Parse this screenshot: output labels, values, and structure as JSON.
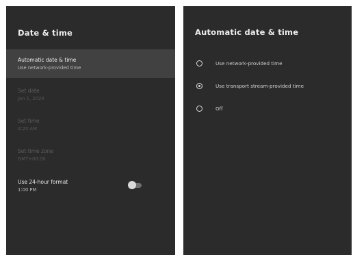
{
  "left": {
    "title": "Date & time",
    "items": [
      {
        "title": "Automatic date & time",
        "subtitle": "Use network-provided time",
        "state": "selected"
      },
      {
        "title": "Set date",
        "subtitle": "Jan 1, 2020",
        "state": "disabled"
      },
      {
        "title": "Set time",
        "subtitle": "4:20 AM",
        "state": "disabled"
      },
      {
        "title": "Set time zone",
        "subtitle": "GMT+00:00",
        "state": "disabled"
      },
      {
        "title": "Use 24-hour format",
        "subtitle": "1:00 PM",
        "state": "normal"
      }
    ],
    "toggle_24h": false
  },
  "right": {
    "title": "Automatic date & time",
    "options": [
      {
        "label": "Use network-provided time",
        "checked": false
      },
      {
        "label": "Use transport stream-provided time",
        "checked": true
      },
      {
        "label": "Off",
        "checked": false
      }
    ]
  },
  "colors": {
    "panel_bg": "#2b2b2b",
    "selected_bg": "#414141",
    "text": "#ececec",
    "disabled_text": "#5e5e5e"
  }
}
